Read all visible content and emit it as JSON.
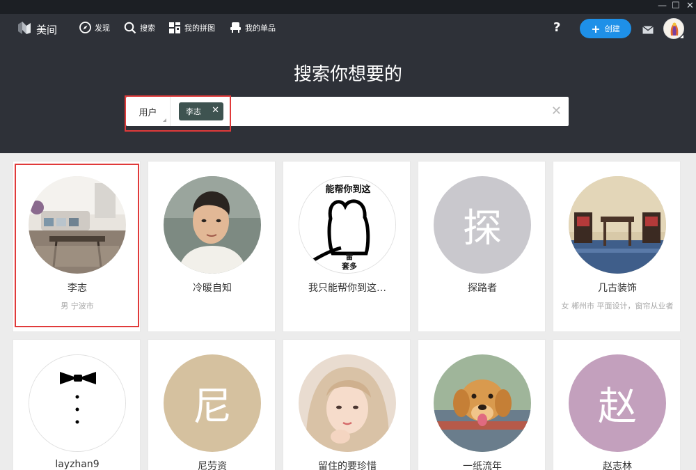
{
  "window": {
    "minimize": "—",
    "maximize": "☐",
    "close": "✕"
  },
  "nav": {
    "logo_text": "美间",
    "items": [
      {
        "label": "发现",
        "icon": "compass-icon"
      },
      {
        "label": "搜索",
        "icon": "search-icon"
      },
      {
        "label": "我的拼图",
        "icon": "puzzle-icon"
      },
      {
        "label": "我的单品",
        "icon": "chair-icon"
      }
    ],
    "help": "?",
    "create_label": "创建",
    "create_plus": "+"
  },
  "search": {
    "title": "搜索你想要的",
    "type_label": "用户",
    "tag_label": "李志",
    "tag_remove": "✕",
    "clear": "✕"
  },
  "colors": {
    "accent": "#1e90e8",
    "header": "#2e3138",
    "highlight": "#e03a3a",
    "tag": "#3e5350"
  },
  "results": [
    {
      "name": "李志",
      "meta": "男 宁波市",
      "avatar": "photo-living-room"
    },
    {
      "name": "冷暖自知",
      "meta": "",
      "avatar": "photo-man"
    },
    {
      "name": "我只能帮你到这…",
      "meta": "",
      "avatar": "drawing-bear"
    },
    {
      "name": "探路者",
      "meta": "",
      "avatar": "letter",
      "letter": "探",
      "color": "#c9c8cd"
    },
    {
      "name": "几古装饰",
      "meta": "女 郴州市 平面设计，窗帘从业者",
      "avatar": "photo-cafe"
    },
    {
      "name": "layzhan9",
      "meta": "",
      "avatar": "drawing-bowtie"
    },
    {
      "name": "尼劳资",
      "meta": "",
      "avatar": "letter",
      "letter": "尼",
      "color": "#d5c19f"
    },
    {
      "name": "留住的要珍惜",
      "meta": "",
      "avatar": "photo-girl"
    },
    {
      "name": "一纸流年",
      "meta": "",
      "avatar": "photo-dog"
    },
    {
      "name": "赵志林",
      "meta": "",
      "avatar": "letter",
      "letter": "赵",
      "color": "#c3a0bd"
    }
  ]
}
